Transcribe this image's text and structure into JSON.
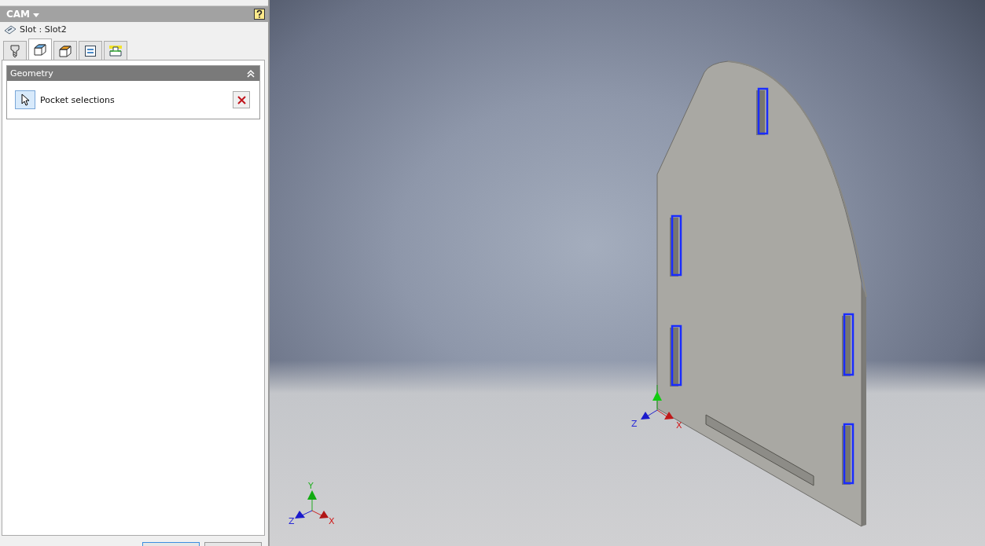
{
  "panel": {
    "title": "CAM",
    "operation": "Slot : Slot2"
  },
  "tabs": [
    {
      "kind": "tool",
      "selected": false
    },
    {
      "kind": "geometry",
      "selected": true
    },
    {
      "kind": "heights",
      "selected": false
    },
    {
      "kind": "passes",
      "selected": false
    },
    {
      "kind": "linking",
      "selected": false
    }
  ],
  "group": {
    "title": "Geometry",
    "expanded": true,
    "selection_label": "Pocket selections"
  },
  "viewport": {
    "model_triad": {
      "z": "Z",
      "x": "X"
    },
    "view_triad": {
      "y": "Y",
      "z": "Z",
      "x": "X"
    }
  }
}
